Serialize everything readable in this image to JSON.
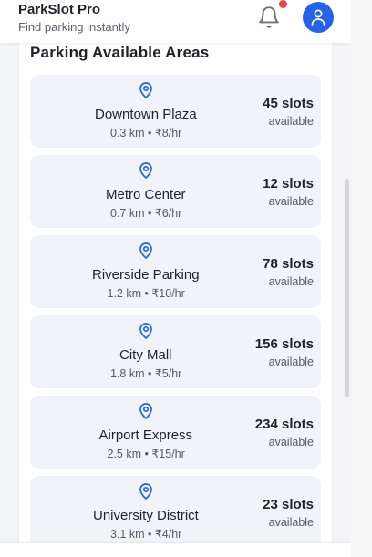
{
  "header": {
    "title": "ParkSlot Pro",
    "subtitle": "Find parking instantly",
    "notification_icon": "bell-icon",
    "profile_icon": "user-icon"
  },
  "colors": {
    "accent": "#2563eb",
    "notification": "#ef4444",
    "card_bg": "#f0f3f7"
  },
  "section": {
    "title": "Parking Available Areas"
  },
  "areas": [
    {
      "name": "Downtown Plaza",
      "distance": "0.3 km",
      "price": "₹8/hr",
      "meta": "0.3 km • ₹8/hr",
      "slots": "45 slots",
      "available": "available"
    },
    {
      "name": "Metro Center",
      "distance": "0.7 km",
      "price": "₹6/hr",
      "meta": "0.7 km • ₹6/hr",
      "slots": "12 slots",
      "available": "available"
    },
    {
      "name": "Riverside Parking",
      "distance": "1.2 km",
      "price": "₹10/hr",
      "meta": "1.2 km • ₹10/hr",
      "slots": "78 slots",
      "available": "available"
    },
    {
      "name": "City Mall",
      "distance": "1.8 km",
      "price": "₹5/hr",
      "meta": "1.8 km • ₹5/hr",
      "slots": "156 slots",
      "available": "available"
    },
    {
      "name": "Airport Express",
      "distance": "2.5 km",
      "price": "₹15/hr",
      "meta": "2.5 km • ₹15/hr",
      "slots": "234 slots",
      "available": "available"
    },
    {
      "name": "University District",
      "distance": "3.1 km",
      "price": "₹4/hr",
      "meta": "3.1 km • ₹4/hr",
      "slots": "23 slots",
      "available": "available"
    }
  ]
}
